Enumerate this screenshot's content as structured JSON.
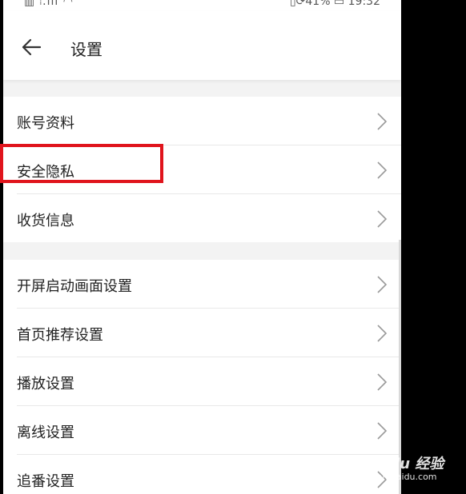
{
  "status_bar": {
    "left": "▥ ᵢ.ıll ◠",
    "right": "▯⟳41% ▭ 19:32"
  },
  "header": {
    "title": "设置"
  },
  "groups": [
    {
      "items": [
        {
          "label": "账号资料"
        },
        {
          "label": "安全隐私"
        },
        {
          "label": "收货信息"
        }
      ]
    },
    {
      "items": [
        {
          "label": "开屏启动画面设置"
        },
        {
          "label": "首页推荐设置"
        },
        {
          "label": "播放设置"
        },
        {
          "label": "离线设置"
        },
        {
          "label": "追番设置"
        }
      ]
    }
  ],
  "annotation": {
    "color": "#e0141c"
  },
  "watermark": {
    "main": "Bai du 经验",
    "sub": "jingyan.baidu.com"
  },
  "colors": {
    "background": "#f3f3f3",
    "text": "#222222",
    "divider": "#e8e8e8"
  }
}
